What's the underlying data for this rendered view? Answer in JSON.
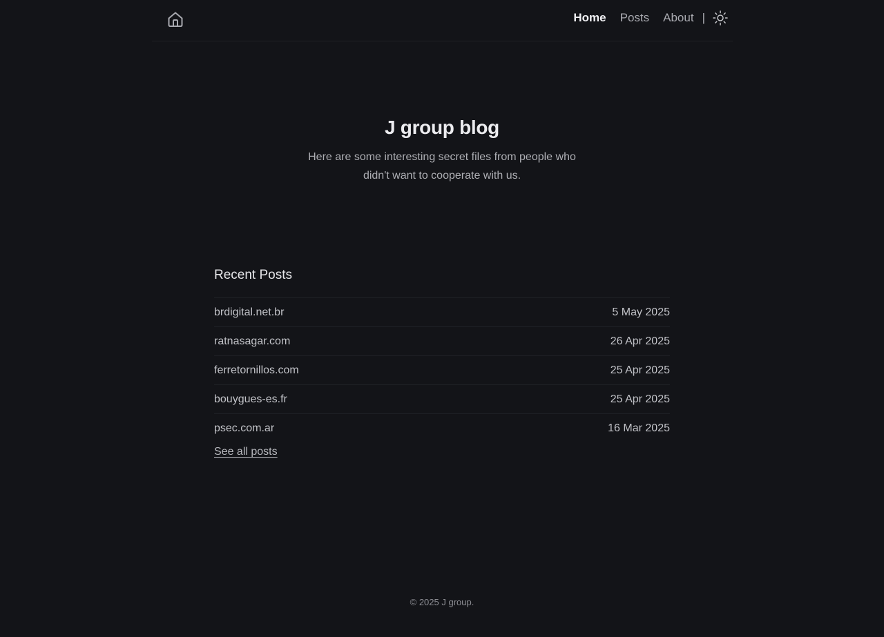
{
  "nav": {
    "logo_icon": "home-icon",
    "items": [
      {
        "label": "Home",
        "active": true
      },
      {
        "label": "Posts",
        "active": false
      },
      {
        "label": "About",
        "active": false
      }
    ],
    "separator": "|",
    "theme_icon": "sun-icon"
  },
  "hero": {
    "title": "J group blog",
    "description": "Here are some interesting secret files from people who didn't want to cooperate with us."
  },
  "recent": {
    "heading": "Recent Posts",
    "posts": [
      {
        "title": "brdigital.net.br",
        "date": "5 May 2025"
      },
      {
        "title": "ratnasagar.com",
        "date": "26 Apr 2025"
      },
      {
        "title": "ferretornillos.com",
        "date": "25 Apr 2025"
      },
      {
        "title": "bouygues-es.fr",
        "date": "25 Apr 2025"
      },
      {
        "title": "psec.com.ar",
        "date": "16 Mar 2025"
      }
    ],
    "see_all": "See all posts"
  },
  "footer": {
    "copyright": "© 2025 J group."
  },
  "colors": {
    "background": "#131418",
    "text_primary": "#ececef",
    "text_secondary": "#aeafb4",
    "divider": "#1f2126"
  }
}
